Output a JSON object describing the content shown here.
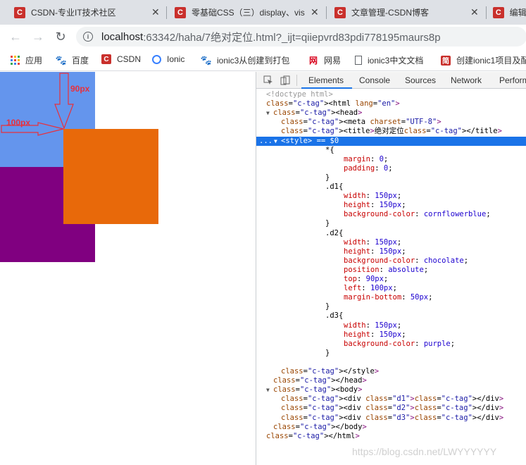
{
  "tabs": [
    {
      "title": "CSDN-专业IT技术社区",
      "favicon": "C"
    },
    {
      "title": "零基础CSS（三）display、vis",
      "favicon": "C"
    },
    {
      "title": "文章管理-CSDN博客",
      "favicon": "C"
    },
    {
      "title": "编辑",
      "favicon": "C"
    }
  ],
  "close_glyph": "✕",
  "nav": {
    "back": "←",
    "forward": "→",
    "reload": "↻"
  },
  "url": {
    "info": "i",
    "host": "localhost",
    "rest": ":63342/haha/7绝对定位.html?_ijt=qiiepvrd83pdi778195maurs8p"
  },
  "bookmarks": [
    {
      "label": "应用",
      "icon": "apps-grid-icon"
    },
    {
      "label": "百度",
      "icon": "baidu-paw-icon"
    },
    {
      "label": "CSDN",
      "icon": "csdn-icon"
    },
    {
      "label": "Ionic",
      "icon": "ionic-icon"
    },
    {
      "label": "ionic3从创建到打包",
      "icon": "baidu-paw-icon"
    },
    {
      "label": "网易",
      "icon": "netease-icon"
    },
    {
      "label": "ionic3中文文档",
      "icon": "document-icon"
    },
    {
      "label": "创建ionic1项目及配",
      "icon": "jian-icon"
    }
  ],
  "annotations": {
    "top_label": "90px",
    "left_label": "100px"
  },
  "colors": {
    "d1": "#6495ed",
    "d2": "#e8690a",
    "d3": "#800080",
    "annot": "#e8303c"
  },
  "devtools_tabs": [
    "Elements",
    "Console",
    "Sources",
    "Network",
    "Perform"
  ],
  "code_lines": [
    "<!doctype html>",
    "<html lang=\"en\">",
    "<head>",
    "<meta charset=\"UTF-8\">",
    "<title>绝对定位</title>",
    "<style> == $0",
    "*{",
    "margin: 0;",
    "padding: 0;",
    "}",
    ".d1{",
    "width: 150px;",
    "height: 150px;",
    "background-color: cornflowerblue;",
    "}",
    ".d2{",
    "width: 150px;",
    "height: 150px;",
    "background-color: chocolate;",
    "position: absolute;",
    "top: 90px;",
    "left: 100px;",
    "margin-bottom: 50px;",
    "}",
    ".d3{",
    "width: 150px;",
    "height: 150px;",
    "background-color:purple;",
    "}",
    "",
    "</style>",
    "</head>",
    "<body>",
    "<div class=\"d1\"></div>",
    "<div class=\"d2\"></div>",
    "<div class=\"d3\"></div>",
    "</body>",
    "</html>"
  ],
  "watermark": "https://blog.csdn.net/LWYYYYYY"
}
